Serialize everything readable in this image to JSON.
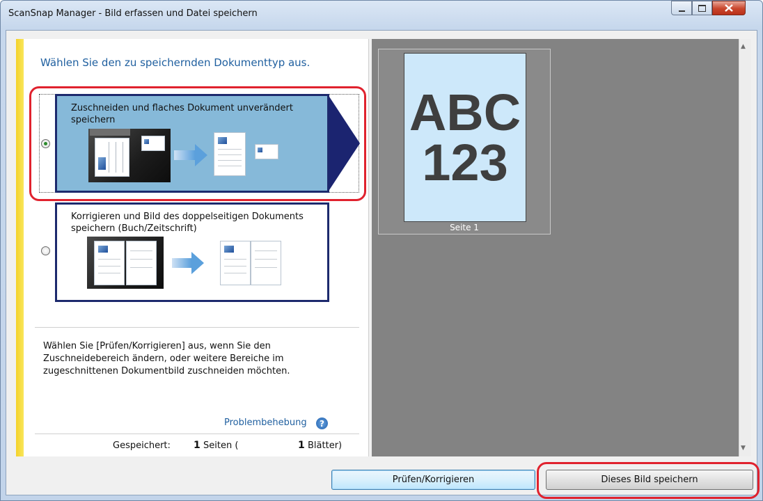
{
  "window": {
    "title": "ScanSnap Manager - Bild erfassen und Datei speichern"
  },
  "left_panel": {
    "heading": "Wählen Sie den zu speichernden Dokumenttyp aus.",
    "options": [
      {
        "label": "Zuschneiden und flaches Dokument unverändert speichern",
        "selected": true
      },
      {
        "label": "Korrigieren und Bild des doppelseitigen Dokuments speichern (Buch/Zeitschrift)",
        "selected": false
      }
    ],
    "help_text": "Wählen Sie [Prüfen/Korrigieren] aus, wenn Sie den Zuschneidebereich ändern, oder weitere Bereiche im zugeschnittenen Dokumentbild zuschneiden möchten.",
    "troubleshooting_link": "Problembehebung",
    "status": {
      "saved_label": "Gespeichert:",
      "pages_count": "1",
      "pages_unit": "Seiten (",
      "sheets_count": "1",
      "sheets_unit": "Blätter)"
    }
  },
  "preview": {
    "page_text_line1": "ABC",
    "page_text_line2": "123",
    "caption": "Seite 1"
  },
  "buttons": {
    "check_correct": "Prüfen/Korrigieren",
    "save_image": "Dieses Bild speichern"
  },
  "colors": {
    "selected_option_bg": "#86b9d9",
    "option_border": "#1d2a6d",
    "highlight_red": "#e0222e",
    "link_blue": "#1f5f9f",
    "preview_bg": "#838383"
  }
}
